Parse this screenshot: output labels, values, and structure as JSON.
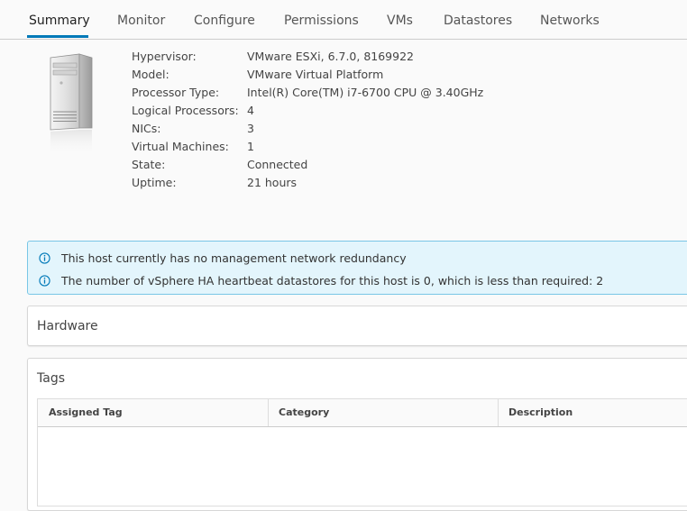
{
  "tabs": [
    {
      "label": "Summary",
      "active": true
    },
    {
      "label": "Monitor"
    },
    {
      "label": "Configure"
    },
    {
      "label": "Permissions"
    },
    {
      "label": "VMs"
    },
    {
      "label": "Datastores"
    },
    {
      "label": "Networks"
    }
  ],
  "host": {
    "icon": "server-tower-icon",
    "properties": [
      {
        "label": "Hypervisor:",
        "value": "VMware ESXi, 6.7.0, 8169922"
      },
      {
        "label": "Model:",
        "value": "VMware Virtual Platform"
      },
      {
        "label": "Processor Type:",
        "value": "Intel(R) Core(TM) i7-6700 CPU @ 3.40GHz"
      },
      {
        "label": "Logical Processors:",
        "value": "4"
      },
      {
        "label": "NICs:",
        "value": "3"
      },
      {
        "label": "Virtual Machines:",
        "value": "1"
      },
      {
        "label": "State:",
        "value": "Connected"
      },
      {
        "label": "Uptime:",
        "value": "21 hours"
      }
    ]
  },
  "alerts": [
    {
      "icon": "info-icon",
      "text": "This host currently has no management network redundancy"
    },
    {
      "icon": "info-icon",
      "text": "The number of vSphere HA heartbeat datastores for this host is 0, which is less than required: 2"
    }
  ],
  "hardware": {
    "title": "Hardware"
  },
  "tags": {
    "title": "Tags",
    "columns": [
      "Assigned Tag",
      "Category",
      "Description"
    ]
  },
  "colors": {
    "accent": "#0079b8",
    "alert_bg": "#e3f5fc",
    "alert_border": "#79c6e6",
    "info_icon": "#0079b8"
  }
}
